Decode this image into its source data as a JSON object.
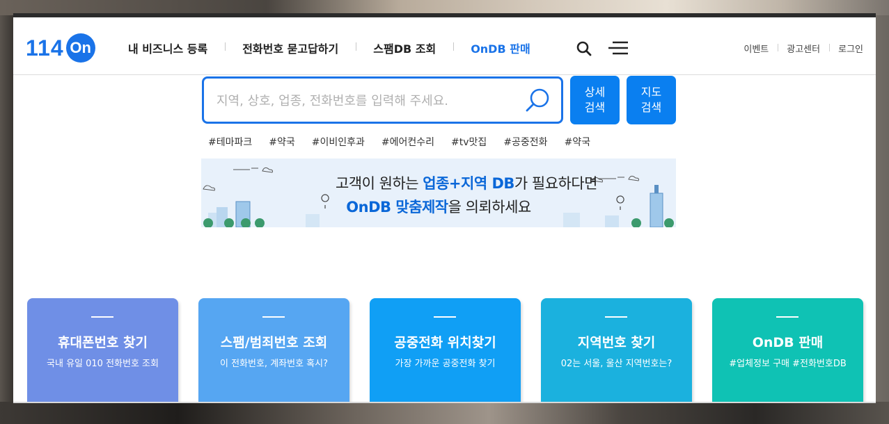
{
  "header": {
    "logo_num": "114",
    "logo_circle": "On",
    "nav": [
      "내 비즈니스 등록",
      "전화번호 묻고답하기",
      "스팸DB 조회",
      "OnDB 판매"
    ],
    "util": [
      "이벤트",
      "광고센터",
      "로그인"
    ]
  },
  "search": {
    "placeholder": "지역, 상호, 업종, 전화번호를 입력해 주세요.",
    "detail_button": "상세\n검색",
    "map_button": "지도\n검색",
    "tags": [
      "#테마파크",
      "#약국",
      "#이비인후과",
      "#에어컨수리",
      "#tv맛집",
      "#공중전화",
      "#약국"
    ]
  },
  "banner": {
    "line1_pre": "고객이 원하는 ",
    "line1_hl": "업종+지역 DB",
    "line1_post": "가 필요하다면",
    "line2_hl": "OnDB 맞춤제작",
    "line2_post": "을 의뢰하세요"
  },
  "cards": [
    {
      "title": "휴대폰번호 찾기",
      "sub": "국내 유일 010 전화번호 조회",
      "color": "#6f8fe6"
    },
    {
      "title": "스팸/범죄번호 조회",
      "sub": "이 전화번호, 계좌번호 혹시?",
      "color": "#56a6f2"
    },
    {
      "title": "공중전화 위치찾기",
      "sub": "가장 가까운 공중전화 찾기",
      "color": "#109ff5"
    },
    {
      "title": "지역번호 찾기",
      "sub": "02는 서울, 울산 지역번호는?",
      "color": "#1bb1de"
    },
    {
      "title": "OnDB 판매",
      "sub": "#업체정보 구매 #전화번호DB",
      "color": "#0fc2b4"
    }
  ],
  "colors": {
    "accent": "#1a73e8",
    "button": "#0a7ff0"
  }
}
